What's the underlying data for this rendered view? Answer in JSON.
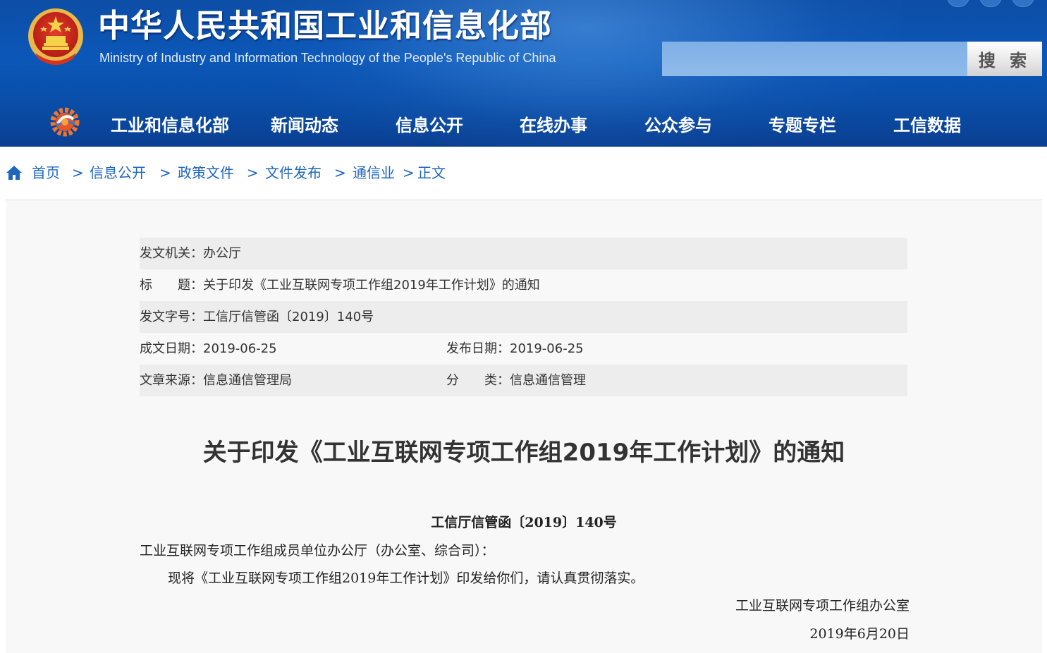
{
  "header": {
    "title": "中华人民共和国工业和信息化部",
    "subtitle": "Ministry of Industry and Information Technology of the People's Republic of China",
    "search_placeholder": "",
    "search_button": "搜 索",
    "colors": {
      "header_bg": "#0b57b8",
      "link": "#1e66c0"
    }
  },
  "nav": {
    "items": [
      {
        "label": "工业和信息化部"
      },
      {
        "label": "新闻动态"
      },
      {
        "label": "信息公开"
      },
      {
        "label": "在线办事"
      },
      {
        "label": "公众参与"
      },
      {
        "label": "专题专栏"
      },
      {
        "label": "工信数据"
      }
    ]
  },
  "breadcrumb": {
    "items": [
      "首页",
      "信息公开",
      "政策文件",
      "文件发布",
      "通信业",
      "正文"
    ],
    "separator": ">"
  },
  "meta": {
    "issuer": "发文机关：办公厅",
    "title": "标　　题：关于印发《工业互联网专项工作组2019年工作计划》的通知",
    "doc_no": "发文字号：工信厅信管函〔2019〕140号",
    "created": "成文日期：2019-06-25",
    "published": "发布日期：2019-06-25",
    "source": "文章来源：信息通信管理局",
    "category": "分　　类：信息通信管理"
  },
  "article": {
    "title": "关于印发《工业互联网专项工作组2019年工作计划》的通知",
    "doc_number": "工信厅信管函〔2019〕140号",
    "salutation": "工业互联网专项工作组成员单位办公厅（办公室、综合司）：",
    "paragraph": "现将《工业互联网专项工作组2019年工作计划》印发给你们，请认真贯彻落实。",
    "signature": "工业互联网专项工作组办公室",
    "date": "2019年6月20日"
  }
}
